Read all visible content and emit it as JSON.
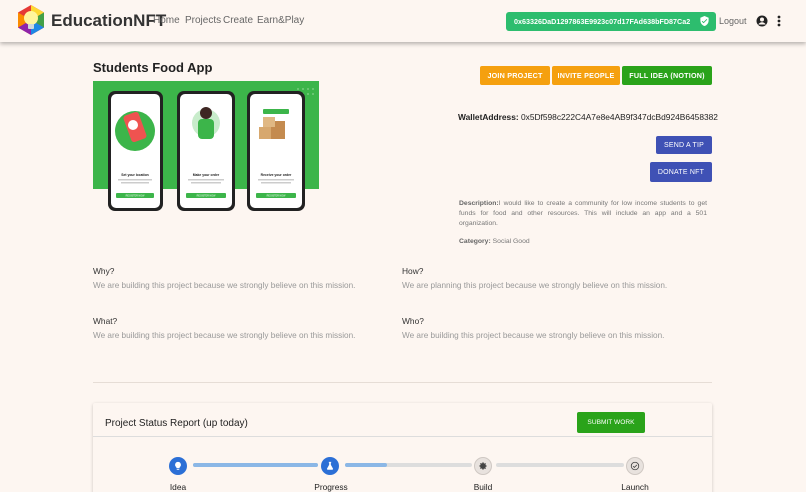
{
  "header": {
    "brand": "EducationNFT",
    "nav": [
      "Home",
      "Projects",
      "Create",
      "Earn&Play"
    ],
    "wallet_address": "0x63326DaD1297863E9923c07d17FAd638bFD87Ca2",
    "logout": "Logout",
    "icons": [
      "account-circle-icon",
      "more-vert-icon",
      "shield-check-icon"
    ]
  },
  "project": {
    "title": "Students Food App",
    "buttons": {
      "join": "JOIN PROJECT",
      "invite": "INVITE PEOPLE",
      "full_idea": "FULL IDEA (NOTION)"
    },
    "wallet_label": "WalletAddress:",
    "wallet_value": "0x5Df598c222C4A7e8e4AB9f347dcBd924B6458382",
    "tip": "SEND A TIP",
    "donate": "DONATE NFT",
    "description_label": "Description:",
    "description": "I would like to create a community for low income students to get funds for food and other resources. This will include an app and a 501 organization.",
    "category_label": "Category:",
    "category": "Social Good"
  },
  "mockup": {
    "screens": [
      {
        "title": "Set your location",
        "button": "REGISTER NOW"
      },
      {
        "title": "Make your order",
        "button": "REGISTER NOW"
      },
      {
        "title": "Receive your order",
        "button": "REGISTER NOW"
      }
    ]
  },
  "questions": {
    "why": {
      "head": "Why?",
      "text": "We are building this project because we strongly believe on this mission."
    },
    "how": {
      "head": "How?",
      "text": "We are planning this project because we strongly believe on this mission."
    },
    "what": {
      "head": "What?",
      "text": "We are building this project because we strongly believe on this mission."
    },
    "who": {
      "head": "Who?",
      "text": "We are building this project because we strongly believe on this mission."
    }
  },
  "status": {
    "title": "Project Status Report (up today)",
    "submit": "SUBMIT WORK",
    "steps": [
      "Idea",
      "Progress",
      "Build",
      "Launch"
    ],
    "progress": [
      1.0,
      0.33,
      0.0
    ]
  },
  "colors": {
    "wallet_green": "#2dbd6e",
    "orange": "#f5a00f",
    "green": "#2aa31a",
    "indigo": "#3f51b5",
    "step_blue": "#2b6fd6",
    "bar_blue": "#8bb7e6"
  }
}
